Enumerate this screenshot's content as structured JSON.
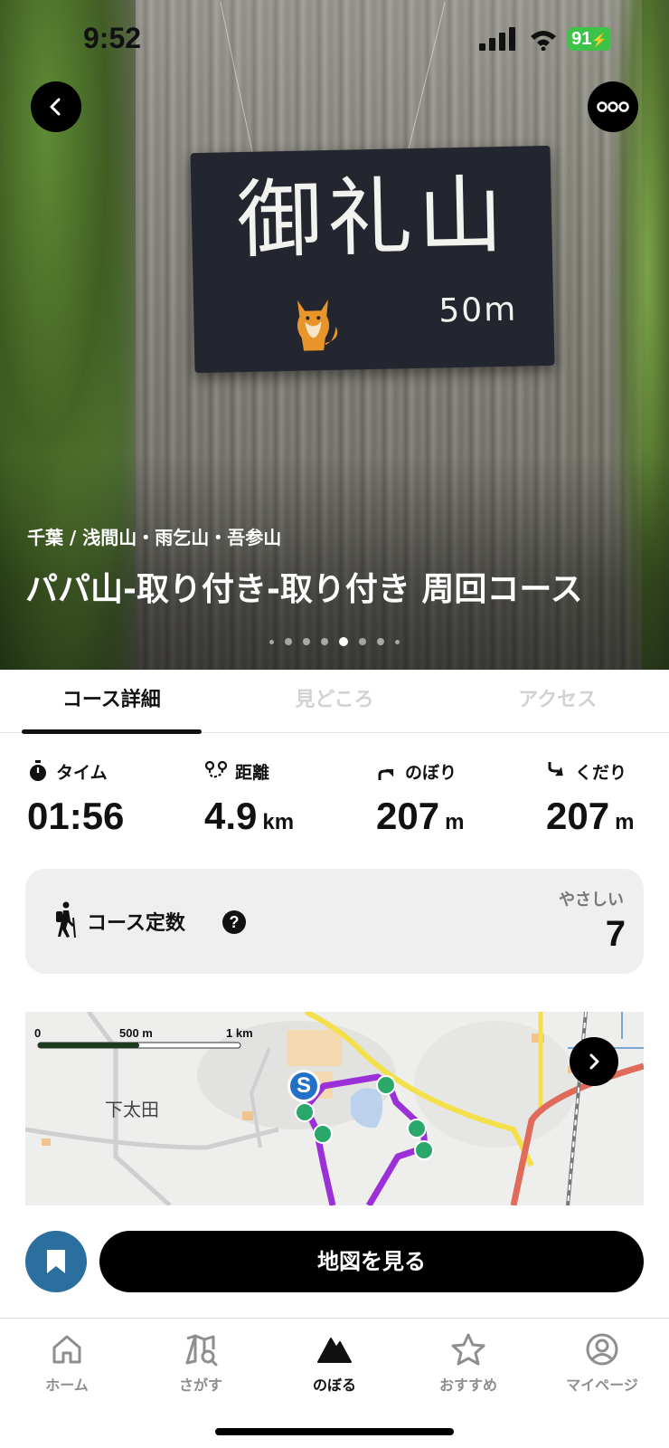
{
  "status_bar": {
    "time": "9:52",
    "battery": "91"
  },
  "hero": {
    "sign_title": "御礼山",
    "sign_elevation": "50m",
    "region": "千葉 / 浅間山・雨乞山・吾参山",
    "course_title": "パパ山-取り付き-取り付き 周回コース",
    "carousel": {
      "count": 8,
      "active_index": 4
    }
  },
  "tabs": [
    {
      "label": "コース詳細",
      "active": true
    },
    {
      "label": "見どころ",
      "active": false
    },
    {
      "label": "アクセス",
      "active": false
    }
  ],
  "stats": {
    "time": {
      "label": "タイム",
      "value": "01:56",
      "unit": ""
    },
    "distance": {
      "label": "距離",
      "value": "4.9",
      "unit": "km"
    },
    "ascent": {
      "label": "のぼり",
      "value": "207",
      "unit": "m"
    },
    "descent": {
      "label": "くだり",
      "value": "207",
      "unit": "m"
    }
  },
  "course_constant": {
    "label": "コース定数",
    "difficulty": "やさしい",
    "value": "7"
  },
  "map": {
    "scale_labels": [
      "0",
      "500 m",
      "1 km"
    ],
    "place_name": "下太田",
    "start_marker": "S"
  },
  "actions": {
    "view_map_label": "地図を見る"
  },
  "bottom_nav": [
    {
      "label": "ホーム",
      "icon": "home-icon",
      "active": false
    },
    {
      "label": "さがす",
      "icon": "map-search-icon",
      "active": false
    },
    {
      "label": "のぼる",
      "icon": "mountain-icon",
      "active": true
    },
    {
      "label": "おすすめ",
      "icon": "star-icon",
      "active": false
    },
    {
      "label": "マイページ",
      "icon": "user-icon",
      "active": false
    }
  ],
  "colors": {
    "route": "#9b30d9",
    "accent_blue": "#2a6f9d",
    "marker_green": "#2aa86b",
    "battery_green": "#3ec34a"
  }
}
